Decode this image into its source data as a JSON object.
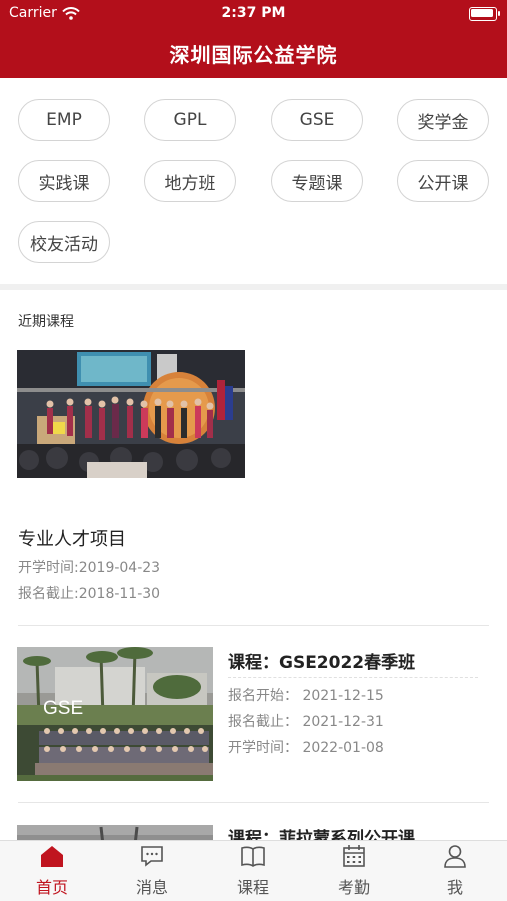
{
  "status_bar": {
    "carrier": "Carrier",
    "time": "2:37 PM"
  },
  "header": {
    "title": "深圳国际公益学院"
  },
  "tags": [
    "EMP",
    "GPL",
    "GSE",
    "奖学金",
    "实践课",
    "地方班",
    "专题课",
    "公开课",
    "校友活动"
  ],
  "recent": {
    "section_title": "近期课程",
    "featured": {
      "name": "专业人才项目",
      "start": "开学时间:2019-04-23",
      "deadline": "报名截止:2018-11-30"
    }
  },
  "courses": [
    {
      "title": "课程：GSE2022春季班",
      "image_label": "GSE",
      "reg_start": "报名开始：  2021-12-15",
      "reg_end": "报名截止：  2021-12-31",
      "school_start": "开学时间：  2022-01-08"
    },
    {
      "title": "课程：菲拉蒙系列公开课"
    }
  ],
  "tabbar": [
    {
      "label": "首页",
      "icon": "home-icon",
      "active": true
    },
    {
      "label": "消息",
      "icon": "message-icon",
      "active": false
    },
    {
      "label": "课程",
      "icon": "book-icon",
      "active": false
    },
    {
      "label": "考勤",
      "icon": "calendar-icon",
      "active": false
    },
    {
      "label": "我",
      "icon": "user-icon",
      "active": false
    }
  ],
  "colors": {
    "brand_red": "#b30f1b",
    "active_tab": "#c0141f"
  }
}
